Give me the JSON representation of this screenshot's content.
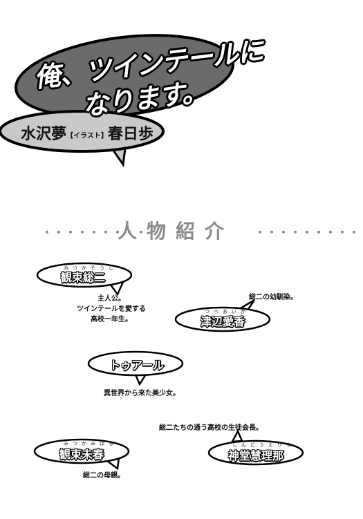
{
  "cover": {
    "title_line1": "俺、ツインテールに",
    "title_line2": "なります。",
    "author": "水沢夢",
    "illust_tag": "【イラスト】",
    "illustrator": "春日歩"
  },
  "section": {
    "dots_left": "・・・・・・・・・",
    "heading": "人物紹介",
    "dots_right": "・・・・・・・・・"
  },
  "characters": [
    {
      "name": "観束総二",
      "ruby": "みつかそうじ",
      "desc": [
        "主人公。",
        "ツインテールを愛する",
        "高校一年生。"
      ]
    },
    {
      "name": "津辺愛香",
      "ruby": "つべあいか",
      "desc": [
        "総二の幼馴染。"
      ]
    },
    {
      "name": "トゥアール",
      "ruby": "",
      "desc": [
        "異世界から来た美少女。"
      ]
    },
    {
      "name": "観束未春",
      "ruby": "みつかみはる",
      "desc": [
        "総二の母親。"
      ]
    },
    {
      "name": "神堂慧理那",
      "ruby": "しんどうえりな",
      "desc": [
        "総二たちの通う高校の生徒会長。"
      ]
    }
  ]
}
